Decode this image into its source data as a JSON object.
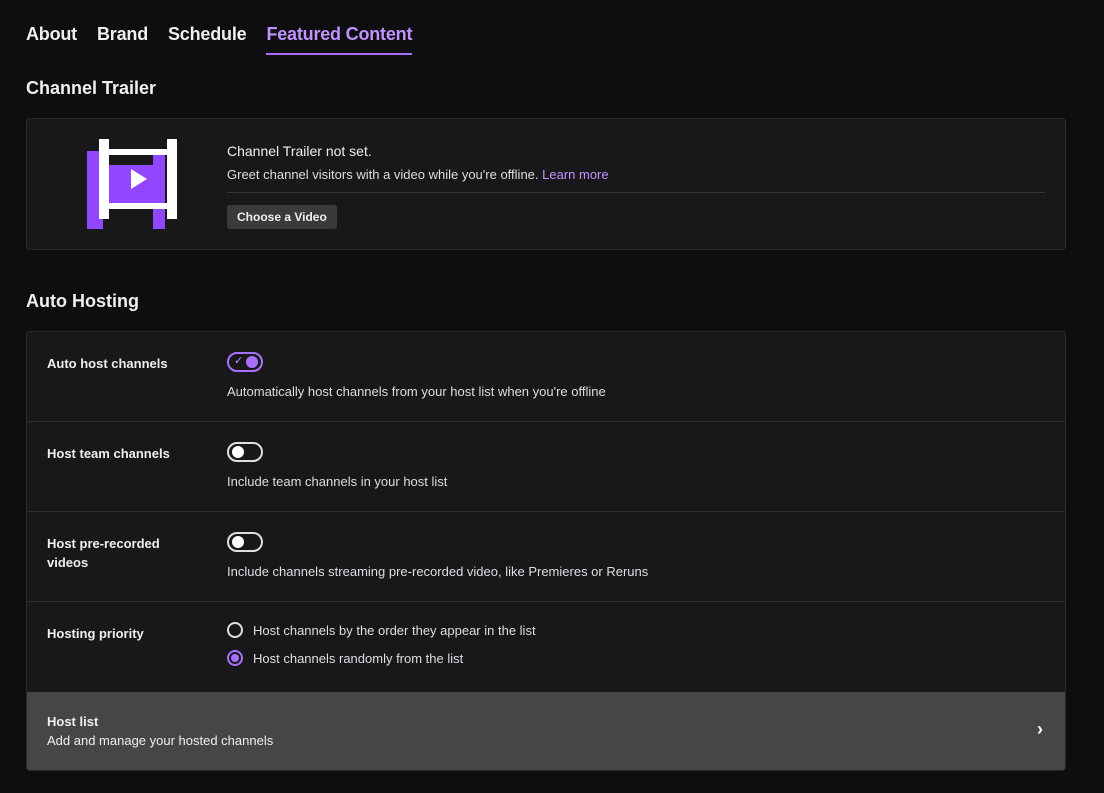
{
  "tabs": [
    {
      "label": "About",
      "active": false
    },
    {
      "label": "Brand",
      "active": false
    },
    {
      "label": "Schedule",
      "active": false
    },
    {
      "label": "Featured Content",
      "active": true
    }
  ],
  "trailer": {
    "section_title": "Channel Trailer",
    "icon": "film-play-icon",
    "status": "Channel Trailer not set.",
    "description": "Greet channel visitors with a video while you're offline.",
    "learn_more": "Learn more",
    "button_label": "Choose a Video"
  },
  "auto_hosting": {
    "section_title": "Auto Hosting",
    "auto_host": {
      "label": "Auto host channels",
      "enabled": true,
      "description": "Automatically host channels from your host list when you're offline"
    },
    "team_channels": {
      "label": "Host team channels",
      "enabled": false,
      "description": "Include team channels in your host list"
    },
    "prerecorded": {
      "label": "Host pre-recorded videos",
      "enabled": false,
      "description": "Include channels streaming pre-recorded video, like Premieres or Reruns"
    },
    "priority": {
      "label": "Hosting priority",
      "options": [
        {
          "label": "Host channels by the order they appear in the list",
          "selected": false
        },
        {
          "label": "Host channels randomly from the list",
          "selected": true
        }
      ]
    },
    "host_list": {
      "title": "Host list",
      "subtitle": "Add and manage your hosted channels",
      "icon": "chevron-right-icon"
    }
  },
  "colors": {
    "accent": "#a970ff",
    "background": "#0e0e10",
    "card": "#18181b"
  }
}
